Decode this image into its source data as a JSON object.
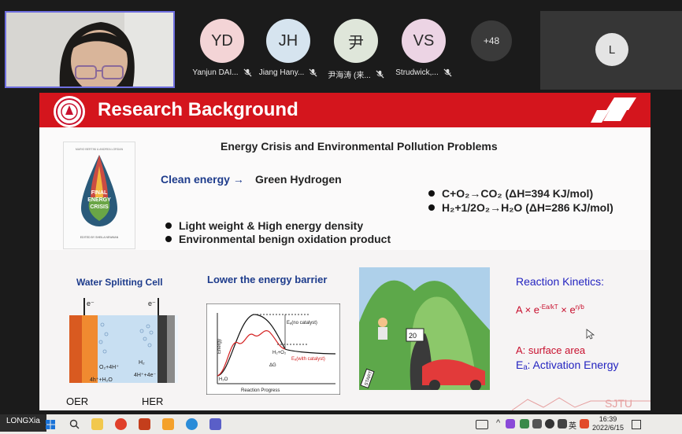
{
  "meeting": {
    "participants": [
      {
        "initials": "YD",
        "name": "Yanjun DAI...",
        "color": "#f3d4d6"
      },
      {
        "initials": "JH",
        "name": "Jiang Hany...",
        "color": "#d6e4ef"
      },
      {
        "initials": "尹",
        "name": "尹海涛 (来...",
        "color": "#dfe6da"
      },
      {
        "initials": "VS",
        "name": "Strudwick,...",
        "color": "#ecd4e4"
      }
    ],
    "more_count": "+48",
    "tile_initial": "L",
    "self_label": "LONGXia"
  },
  "slide": {
    "title": "Research Background",
    "subtitle": "Energy Crisis and Environmental Pollution Problems",
    "book": {
      "top_text": "MARIO BERTINI & ANDREA LORDAN",
      "title_line1": "FINAL",
      "title_line2": "ENERGY",
      "title_line3": "CRISIS",
      "editor": "EDITED BY SHEILA NEWMAN"
    },
    "clean_energy": "Clean energy →",
    "green_hydrogen": "Green Hydrogen",
    "reactions": [
      "C+O₂→CO₂ (ΔH=394 KJ/mol)",
      "H₂+1/2O₂→H₂O (ΔH=286 KJ/mol)"
    ],
    "bullets": [
      "Light weight & High energy density",
      "Environmental benign oxidation product"
    ],
    "water_cell": {
      "label": "Water Splitting Cell",
      "e_left": "e⁻",
      "e_right": "e⁻",
      "o2": "O₂+4H⁺",
      "h2o": "4h⁺+H₂O",
      "h2": "H₂",
      "h4e": "4H⁺+4e⁻",
      "oer": "OER",
      "her": "HER"
    },
    "energy_barrier": {
      "label": "Lower the energy barrier",
      "ylabel": "Energy",
      "xlabel": "Reaction Progress",
      "no_cat": "Eₐ(no catalyst)",
      "with_cat": "Eₐ(with catalyst)",
      "h2o2": "H₂+O₂",
      "dg": "ΔG",
      "h2o": "H₂O"
    },
    "cartoon": {
      "sign1": "20",
      "sign2": "START"
    },
    "kinetics": {
      "title": "Reaction Kinetics:",
      "formula": "A × e^(-Ea/kT) × e^(η/b)",
      "f_a": "A ×",
      "f_e1": "e",
      "f_sup1": "-Ea/kT",
      "f_x": "×",
      "f_e2": "e",
      "f_sup2": "η/b",
      "a_def": "A: surface area",
      "ea_def": "Eₐ: Activation Energy"
    },
    "watermark": "SJTU"
  },
  "taskbar": {
    "time": "16:39",
    "date": "2022/6/15",
    "lang": "英"
  }
}
